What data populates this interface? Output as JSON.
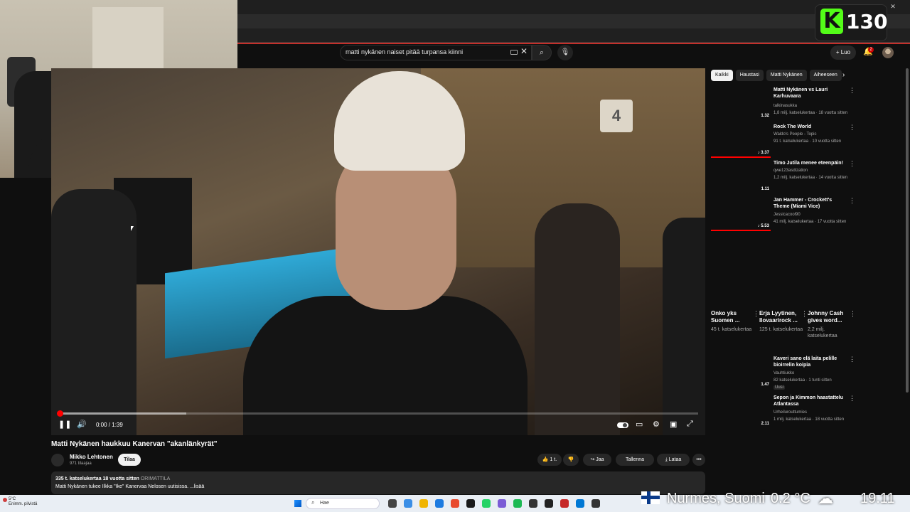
{
  "kick_badge": {
    "logo": "K",
    "viewer_count": "130"
  },
  "window_controls": [
    "–",
    "▫",
    "✕"
  ],
  "masthead": {
    "search_value": "matti nykänen naiset pitää turpansa kiinni",
    "clear_icon": "close-icon",
    "search_icon": "search-icon",
    "mic_icon": "mic-icon",
    "create_label": "Luo",
    "notification_count": "2"
  },
  "player": {
    "time": "0:00 / 1:39",
    "progress_played": 0.005,
    "progress_buffered": 0.2,
    "sign_glyph": "4"
  },
  "video": {
    "title": "Matti Nykänen haukkuu Kanervan \"akanlänkyrät\"",
    "channel": "Mikko Lehtonen",
    "subscribers": "971 tilaajaa",
    "subscribe_label": "Tilaa",
    "likes_label": "1 t.",
    "share_label": "Jaa",
    "save_label": "Tallenna",
    "download_label": "Lataa",
    "more_label": "•••",
    "views_date": "335 t. katselukertaa  18 vuotta sitten",
    "tags": "ORIMATTILA",
    "description": "Matti Nykänen tukee Ilkka \"Ike\" Kanervaa Nelosen uutisissa.  ...lisää"
  },
  "chips": [
    "Kaikki",
    "Haustasi",
    "Matti Nykänen",
    "Aiheeseen"
  ],
  "recommendations": [
    {
      "title": "Matti Nykänen vs Lauri Karhuvaara",
      "channel": "talkinasukka",
      "meta": "1,8 milj. katselukertaa · 18 vuotta sitten",
      "duration": "1.32",
      "watched": false
    },
    {
      "title": "Rock The World",
      "channel": "Waldo's People - Topic",
      "meta": "91 t. katselukertaa · 10 vuotta sitten",
      "duration": "♪ 3.37",
      "watched": true
    },
    {
      "title": "Timo Jutila menee eteenpäin!",
      "channel": "qwe123asdization",
      "meta": "1,2 milj. katselukertaa · 14 vuotta sitten",
      "duration": "1.11",
      "watched": false
    },
    {
      "title": "Jan Hammer - Crockett's Theme (Miami Vice)",
      "channel": "Jessicacool90",
      "meta": "41 milj. katselukertaa · 17 vuotta sitten",
      "duration": "♪ 5.53",
      "watched": true
    }
  ],
  "shorts": [
    {
      "title": "Onko yks Suomen ...",
      "meta": "45 t. katselukertaa"
    },
    {
      "title": "Erja Lyytinen, Ilovaarirock ...",
      "meta": "125 t. katselukertaa"
    },
    {
      "title": "Johnny Cash gives word...",
      "meta": "2,2 milj. katselukertaa"
    }
  ],
  "recommendations_lower": [
    {
      "title": "Kaveri sano elä laita pelille bioirrelin koipia",
      "channel": "Vauhtiukko",
      "meta": "82 katselukertaa · 1 tunti sitten",
      "badge": "Uusi",
      "duration": "1.47"
    },
    {
      "title": "Sepon ja Kimmon haastattelu Atlantassa",
      "channel": "Urheilurouttumies",
      "meta": "1 milj. katselukertaa · 18 vuotta sitten",
      "duration": "2.11"
    }
  ],
  "taskbar": {
    "weather_temp": "5°C",
    "weather_desc": "Enimm. pilvistä",
    "search_placeholder": "Hae",
    "icon_colors": [
      "#444",
      "#3a8ee6",
      "#f0b400",
      "#1e7be0",
      "#e84a2e",
      "#1a1a1a",
      "#25d366",
      "#7b5cd6",
      "#1db954",
      "#333",
      "#222",
      "#c62828",
      "#0078d4",
      "#333"
    ]
  },
  "stream_overlay": {
    "location": "Nurmes, Suomi",
    "temperature": "0.2 °C",
    "weather_icon": "cloud-icon",
    "time": "19.11"
  }
}
